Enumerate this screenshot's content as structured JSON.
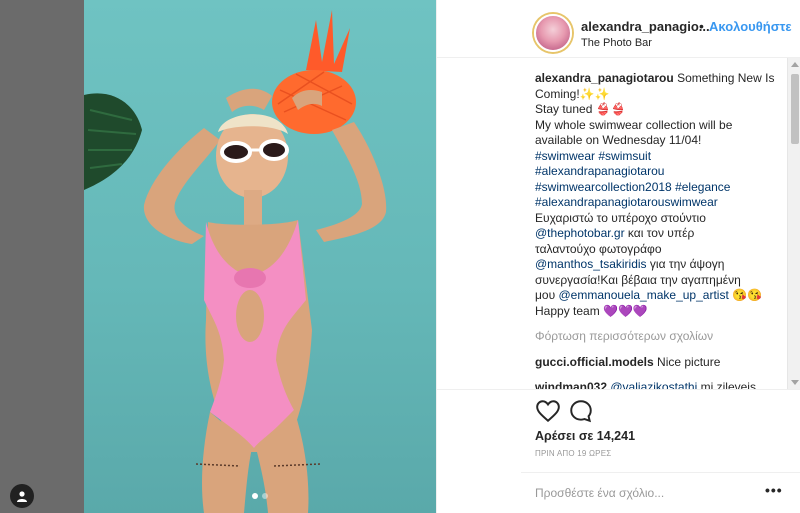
{
  "post": {
    "username": "alexandra_panagio...",
    "follow_separator": "•",
    "follow_label": "Ακολουθήστε",
    "location": "The Photo Bar",
    "carousel": {
      "count": 2,
      "active_index": 0
    }
  },
  "caption": {
    "username": "alexandra_panagiotarou",
    "line1": "Something New Is",
    "line2": "Coming!✨✨",
    "line3": "Stay tuned 👙👙",
    "line4": "My whole swimwear collection will be",
    "line5": "available on Wednesday 11/04!",
    "hashtag_swimwear": "#swimwear",
    "hashtag_swimsuit": "#swimsuit",
    "hashtag_name": "#alexandrapanagiotarou",
    "hashtag_collection": "#swimwearcollection2018",
    "hashtag_elegance": "#elegance",
    "hashtag_brand": "#alexandrapanagiotarouswimwear",
    "greek_line1": "Ευχαριστώ το υπέροχο στούντιο",
    "mention_studio": "@thephotobar.gr",
    "greek_line2_rest": "και τον υπέρ",
    "greek_line3": "ταλαντούχο φωτογράφο",
    "mention_photographer": "@manthos_tsakiridis",
    "greek_line4_rest": "για την άψογη",
    "greek_line5": "συνεργασία!Και βέβαια την αγαπημένη",
    "greek_line6_prefix": "μου",
    "mention_makeup": "@emmanouela_make_up_artist",
    "emoji_makeup": "😘😘",
    "closing": "Happy team 💜💜💜"
  },
  "load_more_label": "Φόρτωση περισσότερων σχολίων",
  "comments": [
    {
      "user": "gucci.official.models",
      "text": "Nice picture"
    },
    {
      "user": "windman032",
      "mention": "@valiazikostathi",
      "text": "mi zileveis..."
    }
  ],
  "actions": {
    "like_icon": "heart-outline-icon",
    "comment_icon": "speech-bubble-icon",
    "likes_label": "Αρέσει σε 14,241",
    "timestamp": "ΠΡΙΝ ΑΠΟ 19 ΩΡΕΣ"
  },
  "add_comment": {
    "placeholder": "Προσθέστε ένα σχόλιο...",
    "more_label": "•••"
  },
  "colors": {
    "link_blue": "#3897f0",
    "hashtag_blue": "#003569",
    "photo_bg": "#6fc3c2",
    "swimsuit_pink": "#f48fc3",
    "pineapple_orange": "#ff6a2e"
  }
}
